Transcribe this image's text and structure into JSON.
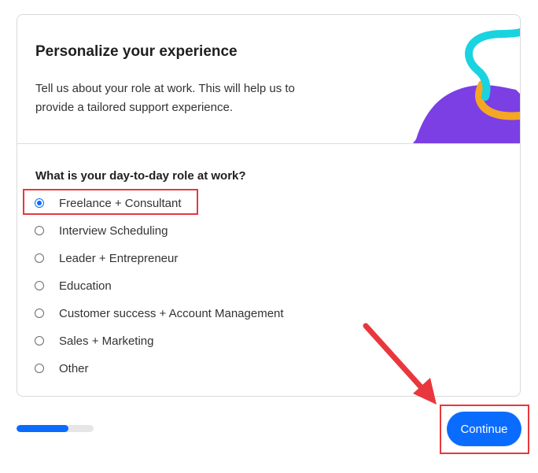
{
  "header": {
    "title": "Personalize your experience",
    "subtitle": "Tell us about your role at work. This will help us to provide a tailored support experience."
  },
  "question": "What is your day-to-day role at work?",
  "options": [
    {
      "label": "Freelance + Consultant",
      "selected": true
    },
    {
      "label": "Interview Scheduling",
      "selected": false
    },
    {
      "label": "Leader + Entrepreneur",
      "selected": false
    },
    {
      "label": "Education",
      "selected": false
    },
    {
      "label": "Customer success + Account Management",
      "selected": false
    },
    {
      "label": "Sales + Marketing",
      "selected": false
    },
    {
      "label": "Other",
      "selected": false
    }
  ],
  "progress": {
    "fraction": 0.67
  },
  "continue_label": "Continue",
  "colors": {
    "accent": "#0a6cff",
    "highlight": "#e8383d",
    "illustration_purple": "#7b3fe4",
    "illustration_cyan": "#19d3e0",
    "illustration_orange": "#f5a623"
  },
  "icons": {
    "illustration": "abstract-shapes-illustration",
    "annotation": "red-arrow-icon"
  }
}
